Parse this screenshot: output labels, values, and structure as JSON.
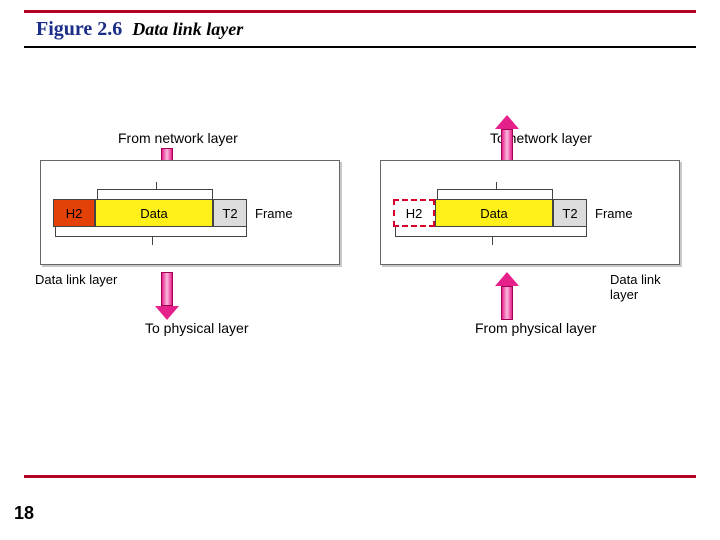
{
  "figure": {
    "number": "Figure 2.6",
    "caption": "Data link layer"
  },
  "labels": {
    "from_network": "From network layer",
    "to_network": "To network layer",
    "to_physical": "To physical layer",
    "from_physical": "From physical layer",
    "dll_left": "Data link layer",
    "dll_right": "Data link layer"
  },
  "frame_parts": {
    "header": "H2",
    "data": "Data",
    "trailer": "T2",
    "frame_label": "Frame"
  },
  "page_number": "18",
  "colors": {
    "accent_red": "#b40024",
    "arrow_pink": "#e6208a",
    "data_yellow": "#fff01a",
    "header_orange": "#e44107",
    "trailer_grey": "#dcdcdc"
  }
}
